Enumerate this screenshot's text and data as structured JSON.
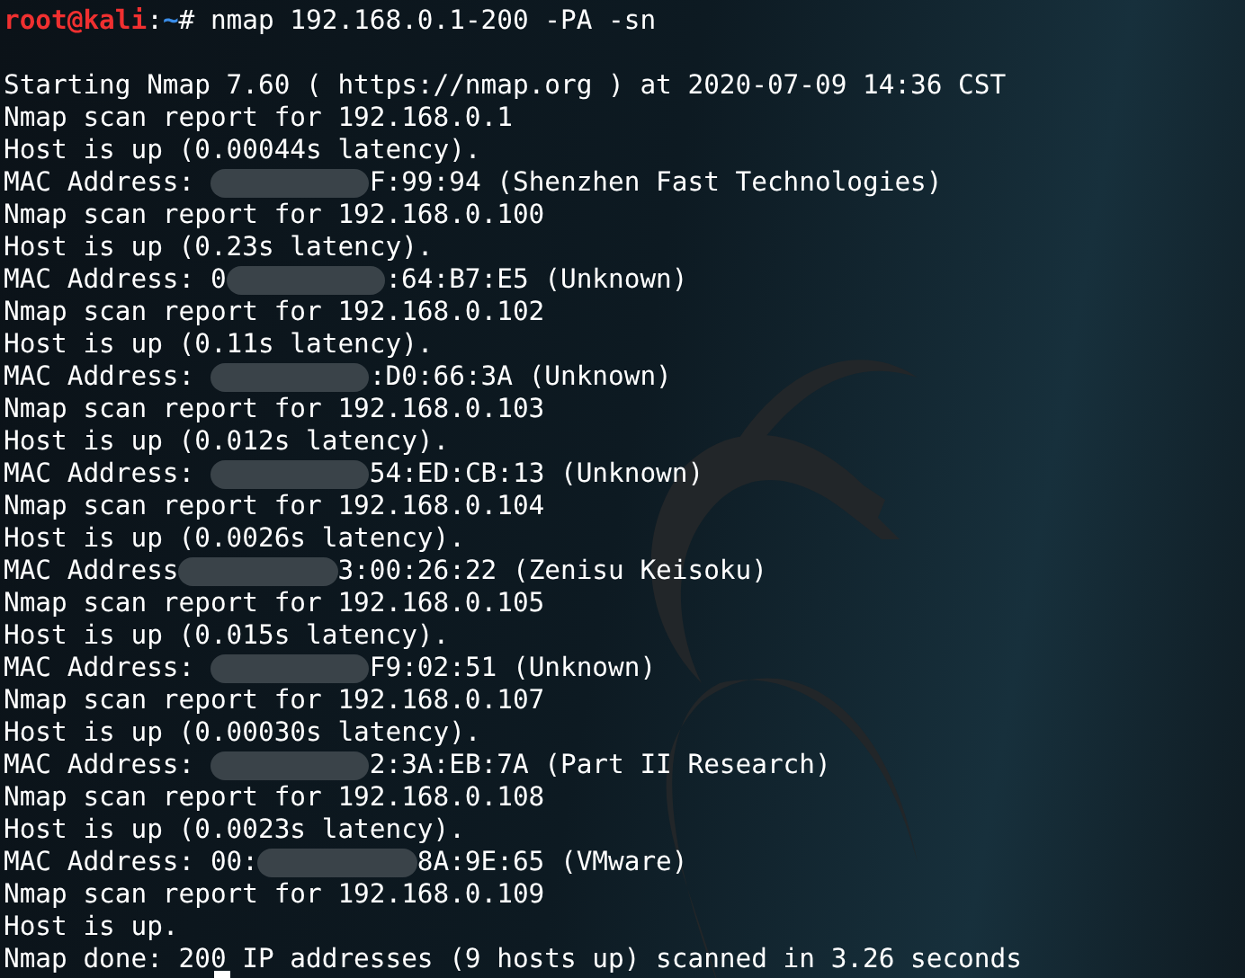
{
  "prompt": {
    "user_host": "root@kali",
    "separator": ":",
    "path": "~",
    "symbol": "#",
    "command": " nmap 192.168.0.1-200 -PA -sn"
  },
  "output": [
    {
      "kind": "blank"
    },
    {
      "kind": "text",
      "text": "Starting Nmap 7.60 ( https://nmap.org ) at 2020-07-09 14:36 CST"
    },
    {
      "kind": "text",
      "text": "Nmap scan report for 192.168.0.1"
    },
    {
      "kind": "text",
      "text": "Host is up (0.00044s latency)."
    },
    {
      "kind": "redacted",
      "before": "MAC Address: ",
      "after": "F:99:94 (Shenzhen Fast Technologies)"
    },
    {
      "kind": "text",
      "text": "Nmap scan report for 192.168.0.100"
    },
    {
      "kind": "text",
      "text": "Host is up (0.23s latency)."
    },
    {
      "kind": "redacted",
      "before": "MAC Address: 0",
      "after": ":64:B7:E5 (Unknown)"
    },
    {
      "kind": "text",
      "text": "Nmap scan report for 192.168.0.102"
    },
    {
      "kind": "text",
      "text": "Host is up (0.11s latency)."
    },
    {
      "kind": "redacted",
      "before": "MAC Address: ",
      "after": ":D0:66:3A (Unknown)"
    },
    {
      "kind": "text",
      "text": "Nmap scan report for 192.168.0.103"
    },
    {
      "kind": "text",
      "text": "Host is up (0.012s latency)."
    },
    {
      "kind": "redacted",
      "before": "MAC Address: ",
      "after": "54:ED:CB:13 (Unknown)"
    },
    {
      "kind": "text",
      "text": "Nmap scan report for 192.168.0.104"
    },
    {
      "kind": "text",
      "text": "Host is up (0.0026s latency)."
    },
    {
      "kind": "redacted",
      "before": "MAC Address",
      "after": "3:00:26:22 (Zenisu Keisoku)"
    },
    {
      "kind": "text",
      "text": "Nmap scan report for 192.168.0.105"
    },
    {
      "kind": "text",
      "text": "Host is up (0.015s latency)."
    },
    {
      "kind": "redacted",
      "before": "MAC Address: ",
      "after": "F9:02:51 (Unknown)"
    },
    {
      "kind": "text",
      "text": "Nmap scan report for 192.168.0.107"
    },
    {
      "kind": "text",
      "text": "Host is up (0.00030s latency)."
    },
    {
      "kind": "redacted",
      "before": "MAC Address: ",
      "after": "2:3A:EB:7A (Part II Research)"
    },
    {
      "kind": "text",
      "text": "Nmap scan report for 192.168.0.108"
    },
    {
      "kind": "text",
      "text": "Host is up (0.0023s latency)."
    },
    {
      "kind": "redacted",
      "before": "MAC Address: 00:",
      "after": "8A:9E:65 (VMware)"
    },
    {
      "kind": "text",
      "text": "Nmap scan report for 192.168.0.109"
    },
    {
      "kind": "text",
      "text": "Host is up."
    },
    {
      "kind": "text",
      "text": "Nmap done: 200 IP addresses (9 hosts up) scanned in 3.26 seconds"
    }
  ],
  "cursor": {
    "visible": true
  }
}
